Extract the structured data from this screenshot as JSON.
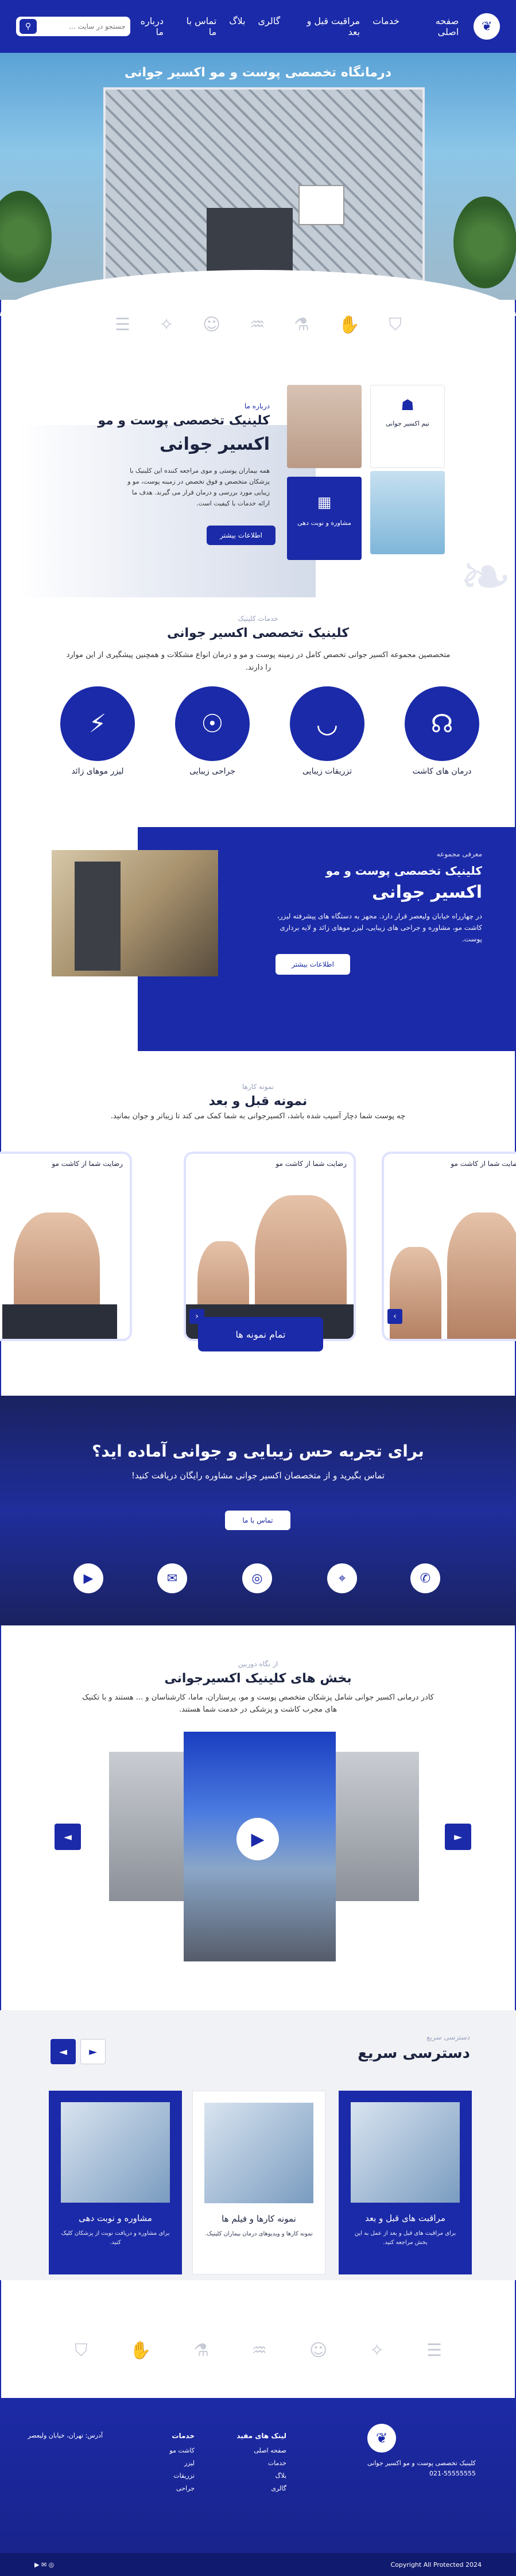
{
  "header": {
    "nav": [
      "صفحه اصلی",
      "خدمات",
      "مراقبت قبل و بعد",
      "گالری",
      "بلاگ",
      "تماس با ما",
      "درباره ما"
    ],
    "search_placeholder": "جستجو در سایت ..."
  },
  "hero": {
    "title": "درمانگاه تخصصی پوست و مو اکسیر جوانی"
  },
  "about": {
    "kicker": "درباره ما",
    "title_line1": "کلینیک تخصصی پوست و مو",
    "title_line2": "اکسیر جوانی",
    "text": "همه بیماران پوستی و موی مراجعه کننده این کلینیک با پزشکان متخصص و فوق تخصص در زمینه پوست، مو و زیبایی مورد بررسی و درمان قرار می گیرند. هدف ما ارائه خدمات با کیفیت است.",
    "button": "اطلاعات بیشتر",
    "card_label": "مشاوره و نوبت دهی",
    "team_label": "تیم اکسیر جوانی"
  },
  "services": {
    "kicker": "خدمات کلینیک",
    "title": "کلینیک تخصصی اکسیر جوانی",
    "desc": "متخصصین مجموعه اکسیر جوانی تخصص کامل در زمینه پوست و مو و درمان انواع مشکلات و همچنین پیشگیری از این موارد را دارند.",
    "items": [
      "درمان های کاشت",
      "تزریقات زیبایی",
      "جراحی زیبایی",
      "لیزر موهای زائد"
    ]
  },
  "intro": {
    "kicker": "معرفی مجموعه",
    "title_line1": "کلینیک تخصصی پوست و مو",
    "title_line2": "اکسیر جوانی",
    "text": "در چهارراه خیابان ولیعصر قرار دارد. مجهز به دستگاه های پیشرفته لیزر، کاشت مو، مشاوره و جراحی های زیبایی، لیزر موهای زائد و لایه برداری پوست.",
    "button": "اطلاعات بیشتر"
  },
  "before_after": {
    "kicker": "نمونه کارها",
    "title": "نمونه قبل و بعد",
    "desc": "چه پوست شما دچار آسیب شده باشد، اکسیرجوانی به شما کمک می کند تا زیباتر و جوان بمانید.",
    "card_title": "رضایت شما از کاشت مو",
    "button": "تمام نمونه ها"
  },
  "cta": {
    "title": "برای تجربه حس زیبایی و جوانی آماده اید؟",
    "subtitle": "تماس بگیرید و از متخصصان اکسیر جوانی مشاوره رایگان دریافت کنید!",
    "button": "تماس با ما",
    "socials": [
      "phone-icon",
      "location-icon",
      "instagram-icon",
      "whatsapp-icon",
      "youtube-icon"
    ]
  },
  "departments": {
    "kicker": "از نگاه دوربین",
    "title": "بخش های کلینیک اکسیرجوانی",
    "desc": "کادر درمانی اکسیر جوانی شامل پزشکان متخصص پوست و مو، پرستاران، ماما، کارشناسان و ... هستند و با تکنیک های مجرب کاشت و پزشکی در خدمت شما هستند."
  },
  "quick": {
    "kicker": "دسترسی سریع",
    "title": "دسترسی سریع",
    "cards": [
      {
        "title": "مراقبت های قبل و بعد",
        "text": "برای مراقبت های قبل و بعد از عمل به این بخش مراجعه کنید."
      },
      {
        "title": "نمونه کارها و فیلم ها",
        "text": "نمونه کارها و ویدیوهای درمان بیماران کلینیک."
      },
      {
        "title": "مشاوره و نوبت دهی",
        "text": "برای مشاوره و دریافت نوبت از پزشکان کلیک کنید."
      }
    ]
  },
  "footer": {
    "brand": "کلینیک تخصصی پوست و مو اکسیر جوانی",
    "phone": "021-55555555",
    "col1_title": "لینک های مفید",
    "col1": [
      "صفحه اصلی",
      "خدمات",
      "بلاگ",
      "گالری"
    ],
    "col2_title": "خدمات",
    "col2": [
      "کاشت مو",
      "لیزر",
      "تزریقات",
      "جراحی"
    ],
    "copyright": "2024 Copyright All Protected",
    "address": "آدرس: تهران، خیابان ولیعصر"
  },
  "colors": {
    "primary": "#1b2aa8",
    "dark": "#1c2340"
  }
}
